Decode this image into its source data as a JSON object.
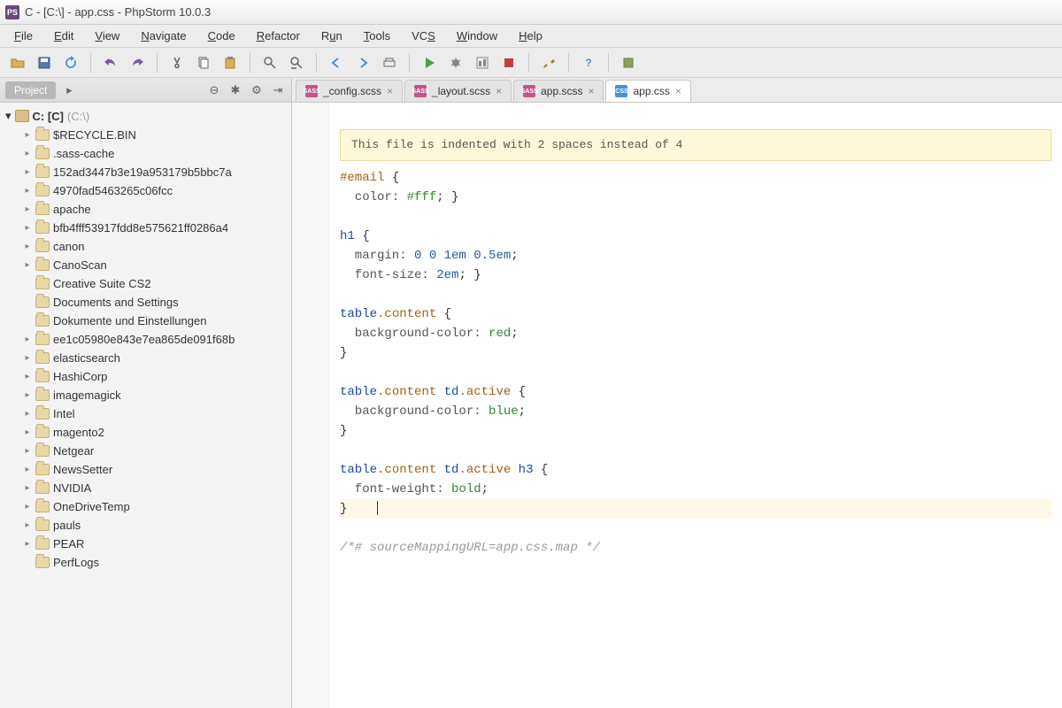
{
  "window": {
    "title": "C - [C:\\] - app.css - PhpStorm 10.0.3"
  },
  "menu": {
    "items": [
      "File",
      "Edit",
      "View",
      "Navigate",
      "Code",
      "Refactor",
      "Run",
      "Tools",
      "VCS",
      "Window",
      "Help"
    ]
  },
  "sidebar": {
    "project_label": "Project",
    "root_label": "C: [C]",
    "root_hint": "(C:\\)",
    "items": [
      {
        "label": "$RECYCLE.BIN",
        "expandable": true
      },
      {
        "label": ".sass-cache",
        "expandable": true
      },
      {
        "label": "152ad3447b3e19a953179b5bbc7a",
        "expandable": true
      },
      {
        "label": "4970fad5463265c06fcc",
        "expandable": true
      },
      {
        "label": "apache",
        "expandable": true
      },
      {
        "label": "bfb4fff53917fdd8e575621ff0286a4",
        "expandable": true
      },
      {
        "label": "canon",
        "expandable": true
      },
      {
        "label": "CanoScan",
        "expandable": true
      },
      {
        "label": "Creative Suite CS2",
        "expandable": false
      },
      {
        "label": "Documents and Settings",
        "expandable": false
      },
      {
        "label": "Dokumente und Einstellungen",
        "expandable": false
      },
      {
        "label": "ee1c05980e843e7ea865de091f68b",
        "expandable": true
      },
      {
        "label": "elasticsearch",
        "expandable": true
      },
      {
        "label": "HashiCorp",
        "expandable": true
      },
      {
        "label": "imagemagick",
        "expandable": true
      },
      {
        "label": "Intel",
        "expandable": true
      },
      {
        "label": "magento2",
        "expandable": true
      },
      {
        "label": "Netgear",
        "expandable": true
      },
      {
        "label": "NewsSetter",
        "expandable": true
      },
      {
        "label": "NVIDIA",
        "expandable": true
      },
      {
        "label": "OneDriveTemp",
        "expandable": true
      },
      {
        "label": "pauls",
        "expandable": true
      },
      {
        "label": "PEAR",
        "expandable": true
      },
      {
        "label": "PerfLogs",
        "expandable": false
      }
    ]
  },
  "tabs": [
    {
      "label": "_config.scss",
      "type": "sass",
      "active": false
    },
    {
      "label": "_layout.scss",
      "type": "sass",
      "active": false
    },
    {
      "label": "app.scss",
      "type": "sass",
      "active": false
    },
    {
      "label": "app.css",
      "type": "css",
      "active": true
    }
  ],
  "editor": {
    "notice": "This file is indented with 2 spaces instead of 4",
    "code": {
      "l1_sel": "#email",
      "l1_brace": " {",
      "l2_prop": "  color:",
      "l2_val": " #fff",
      "l2_end": "; }",
      "l4_tag": "h1",
      "l4_brace": " {",
      "l5_prop": "  margin:",
      "l5_val": " 0 0 1em 0.5em",
      "l5_end": ";",
      "l6_prop": "  font-size:",
      "l6_val": " 2em",
      "l6_end": "; }",
      "l8_tag": "table",
      "l8_class": ".content",
      "l8_brace": " {",
      "l9_prop": "  background-color:",
      "l9_val": " red",
      "l9_end": ";",
      "l10": "}",
      "l12_tag1": "table",
      "l12_class1": ".content",
      "l12_sp1": " ",
      "l12_tag2": "td",
      "l12_class2": ".active",
      "l12_brace": " {",
      "l13_prop": "  background-color:",
      "l13_val": " blue",
      "l13_end": ";",
      "l14": "}",
      "l16_tag1": "table",
      "l16_class1": ".content",
      "l16_sp1": " ",
      "l16_tag2": "td",
      "l16_class2": ".active",
      "l16_sp2": " ",
      "l16_tag3": "h3",
      "l16_brace": " {",
      "l17_prop": "  font-weight:",
      "l17_val": " bold",
      "l17_end": ";",
      "l18": "}",
      "l20_comment": "/*# sourceMappingURL=app.css.map */"
    }
  }
}
